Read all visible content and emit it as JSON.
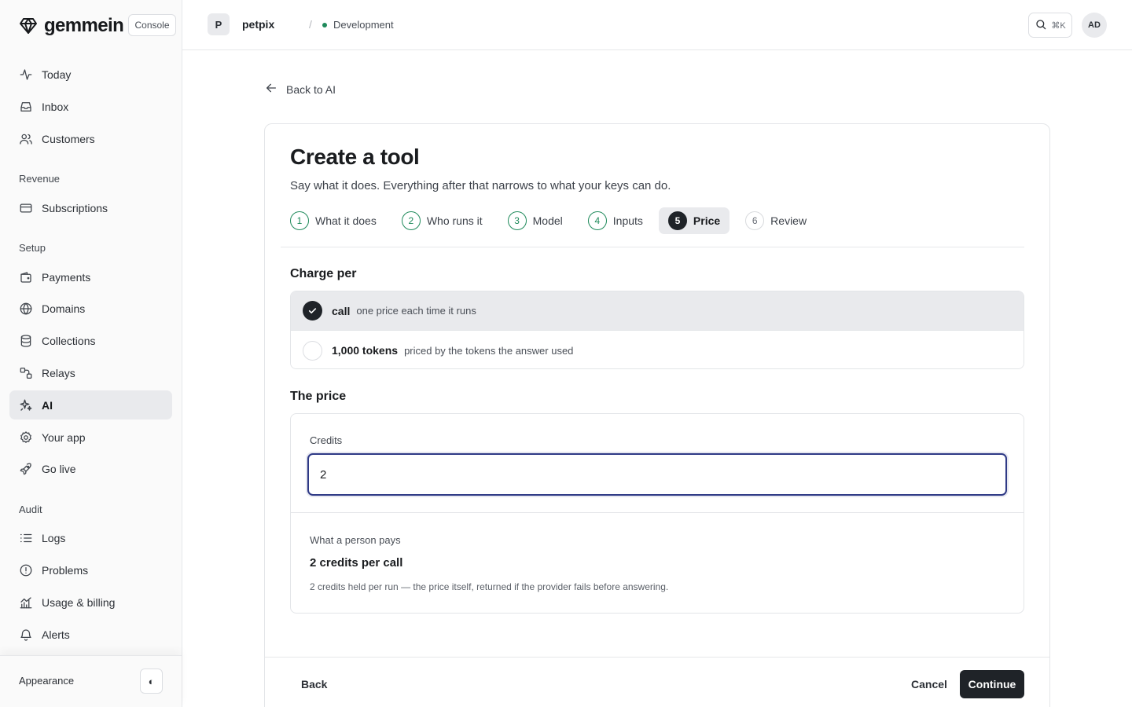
{
  "brand": {
    "name": "gemmein",
    "badge": "Console"
  },
  "sidebar": {
    "items": [
      {
        "label": "Today",
        "icon": "activity-icon"
      },
      {
        "label": "Inbox",
        "icon": "inbox-icon"
      },
      {
        "label": "Customers",
        "icon": "users-icon"
      }
    ],
    "sections": [
      {
        "title": "Revenue",
        "items": [
          {
            "label": "Subscriptions",
            "icon": "credit-card-icon"
          }
        ]
      },
      {
        "title": "Setup",
        "items": [
          {
            "label": "Payments",
            "icon": "wallet-icon"
          },
          {
            "label": "Domains",
            "icon": "globe-icon"
          },
          {
            "label": "Collections",
            "icon": "database-icon"
          },
          {
            "label": "Relays",
            "icon": "relay-icon"
          },
          {
            "label": "AI",
            "icon": "sparkles-icon",
            "active": true
          },
          {
            "label": "Your app",
            "icon": "gear-icon"
          },
          {
            "label": "Go live",
            "icon": "rocket-icon"
          }
        ]
      },
      {
        "title": "Audit",
        "items": [
          {
            "label": "Logs",
            "icon": "list-icon"
          },
          {
            "label": "Problems",
            "icon": "alert-circle-icon"
          },
          {
            "label": "Usage & billing",
            "icon": "bar-chart-icon"
          },
          {
            "label": "Alerts",
            "icon": "bell-icon"
          }
        ]
      }
    ],
    "appearance_label": "Appearance",
    "theme_toggle_glyph": "◐"
  },
  "topbar": {
    "project_initial": "P",
    "project_name": "petpix",
    "separator": "/",
    "environment": "Development",
    "search_shortcut": "⌘K",
    "user_initials": "AD"
  },
  "page": {
    "back_label": "Back to AI",
    "title": "Create a tool",
    "subtitle": "Say what it does. Everything after that narrows to what your keys can do.",
    "steps": [
      {
        "num": "1",
        "label": "What it does",
        "state": "done"
      },
      {
        "num": "2",
        "label": "Who runs it",
        "state": "done"
      },
      {
        "num": "3",
        "label": "Model",
        "state": "done"
      },
      {
        "num": "4",
        "label": "Inputs",
        "state": "done"
      },
      {
        "num": "5",
        "label": "Price",
        "state": "current"
      },
      {
        "num": "6",
        "label": "Review",
        "state": "pending"
      }
    ],
    "charge_per": {
      "title": "Charge per",
      "options": [
        {
          "name": "call",
          "desc": "one price each time it runs",
          "selected": true
        },
        {
          "name": "1,000 tokens",
          "desc": "priced by the tokens the answer used",
          "selected": false
        }
      ]
    },
    "price": {
      "title": "The price",
      "credits_label": "Credits",
      "credits_value": "2",
      "pays_label": "What a person pays",
      "pays_value": "2 credits per call",
      "pays_note": "2 credits held per run — the price itself, returned if the provider fails before answering."
    },
    "footer": {
      "back": "Back",
      "cancel": "Cancel",
      "continue": "Continue"
    }
  },
  "colors": {
    "accent": "#1f8a5b",
    "primary": "#1f2328",
    "focus": "#2f3a86"
  }
}
